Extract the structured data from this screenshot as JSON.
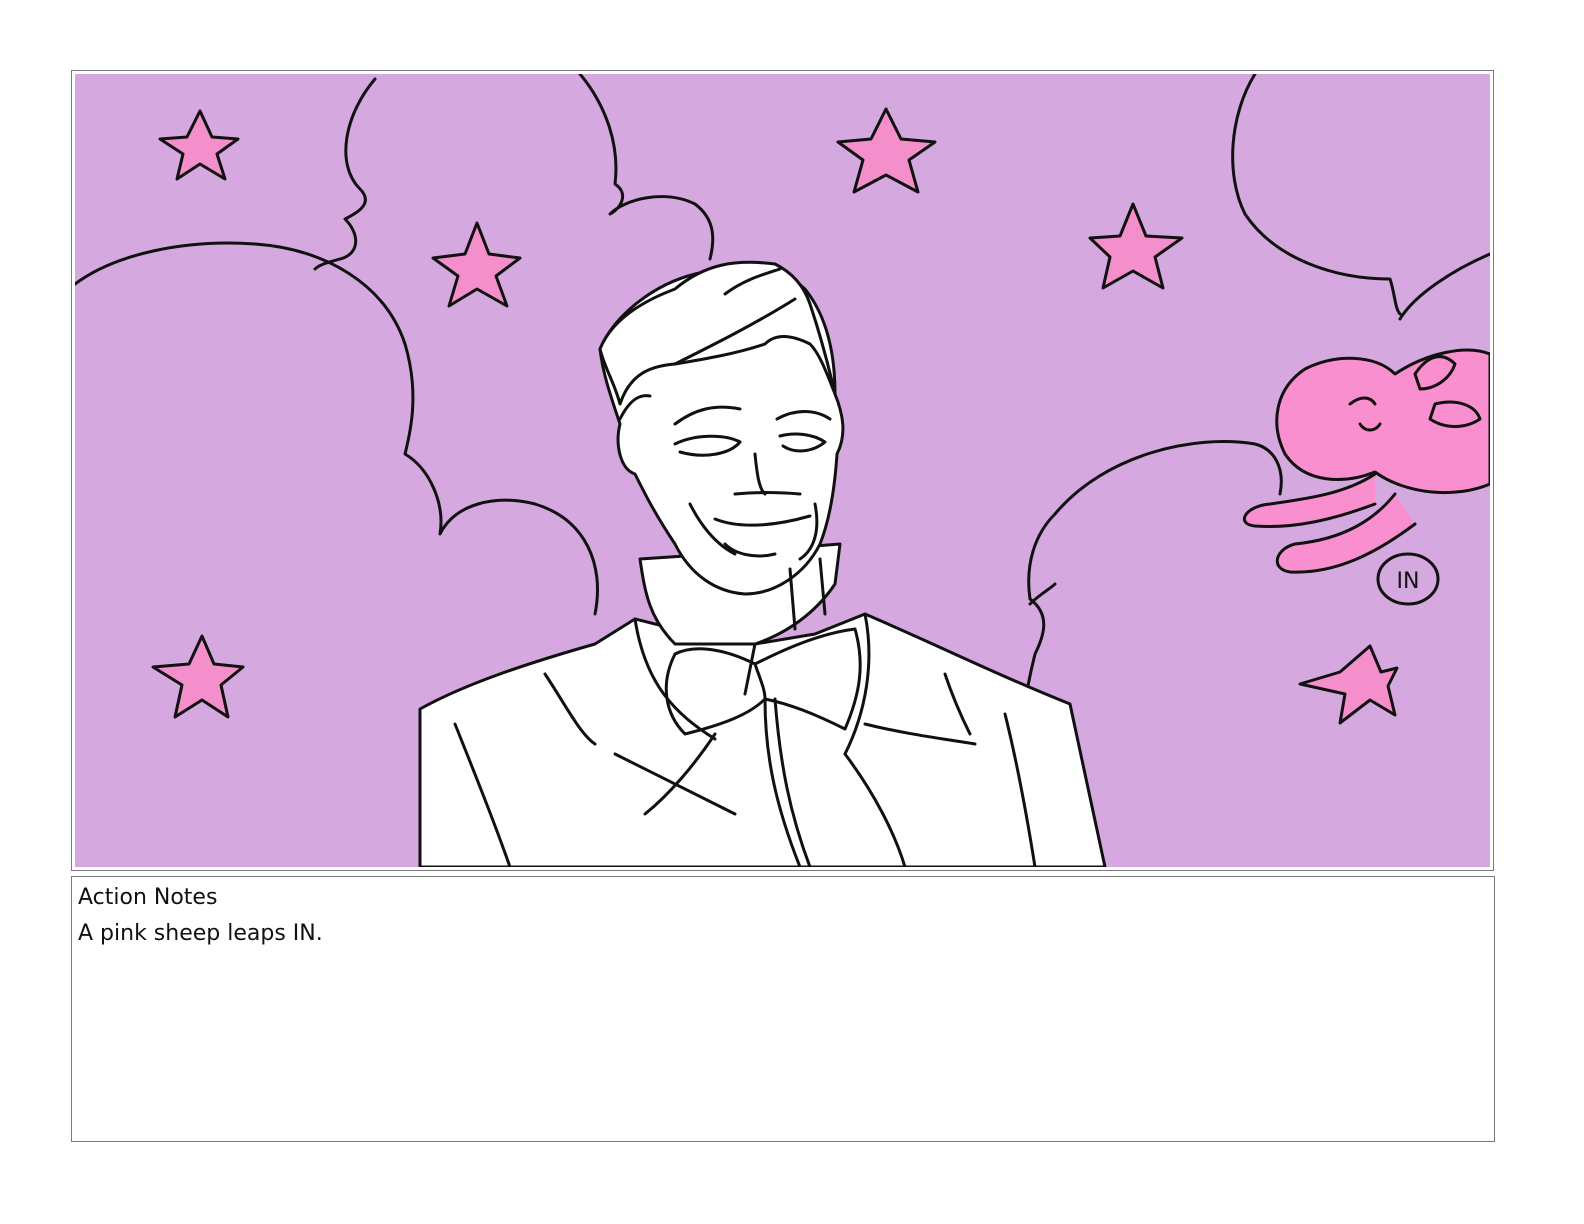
{
  "colors": {
    "background_purple": "#d5a9e0",
    "star_pink": "#f58fcb",
    "sheep_pink": "#f98fcf",
    "line_black": "#111111",
    "frame_gray": "#7a7a7a"
  },
  "panel": {
    "artist_mark": "IN"
  },
  "notes": {
    "title": "Action Notes",
    "text": "A pink sheep leaps IN."
  }
}
